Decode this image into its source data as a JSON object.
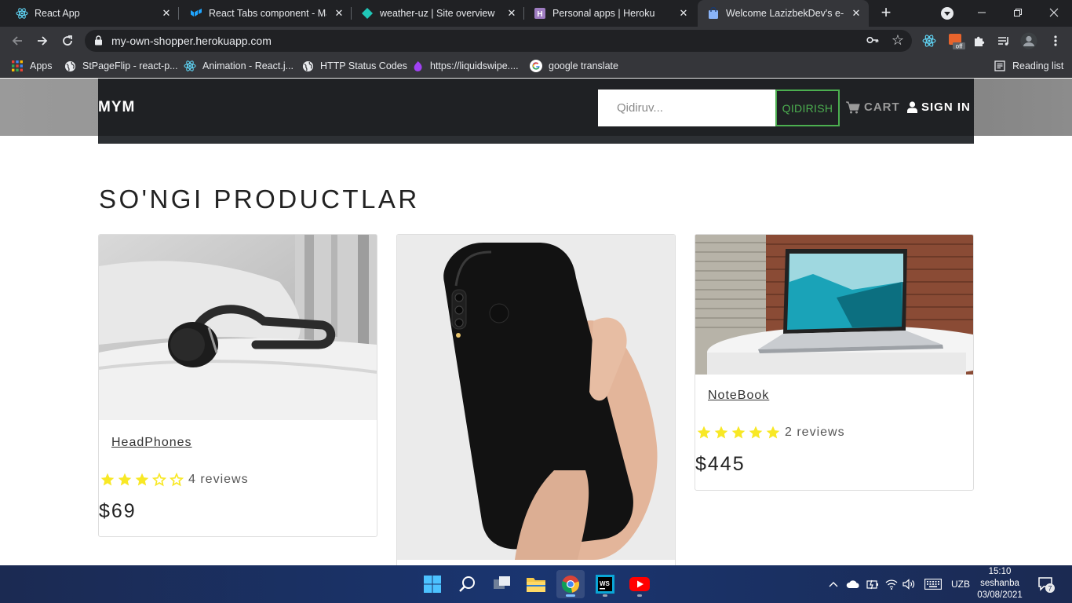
{
  "browser": {
    "tabs": [
      {
        "title": "React App",
        "active": false
      },
      {
        "title": "React Tabs component - Material",
        "active": false
      },
      {
        "title": "weather-uz | Site overview",
        "active": false
      },
      {
        "title": "Personal apps | Heroku",
        "active": false
      },
      {
        "title": "Welcome LazizbekDev's e-commerce",
        "active": true
      }
    ],
    "url": "my-own-shopper.herokuapp.com",
    "bookmarks": [
      {
        "label": "Apps"
      },
      {
        "label": "StPageFlip - react-p..."
      },
      {
        "label": "Animation - React.j..."
      },
      {
        "label": "HTTP Status Codes"
      },
      {
        "label": "https://liquidswipe...."
      },
      {
        "label": "google translate"
      }
    ],
    "reading_list": "Reading list",
    "ext_badge": "off"
  },
  "site": {
    "brand": "MYM",
    "search_placeholder": "Qidiruv...",
    "search_button": "QIDIRISH",
    "cart_label": "CART",
    "signin_label": "SIGN IN",
    "section_title": "SO'NGI PRODUCTLAR",
    "products": [
      {
        "name": "HeadPhones",
        "rating": 3,
        "reviews": "4 reviews",
        "price": "$69"
      },
      {
        "name": "",
        "rating": null,
        "reviews": "",
        "price": ""
      },
      {
        "name": "NoteBook",
        "rating": 5,
        "reviews": "2 reviews",
        "price": "$445"
      }
    ]
  },
  "taskbar": {
    "language": "UZB",
    "time": "15:10",
    "day": "seshanba",
    "date": "03/08/2021",
    "notifications": "7"
  },
  "colors": {
    "navbar": "#1f2124",
    "accent_green": "#4caf50",
    "star_yellow": "#f8e825"
  }
}
